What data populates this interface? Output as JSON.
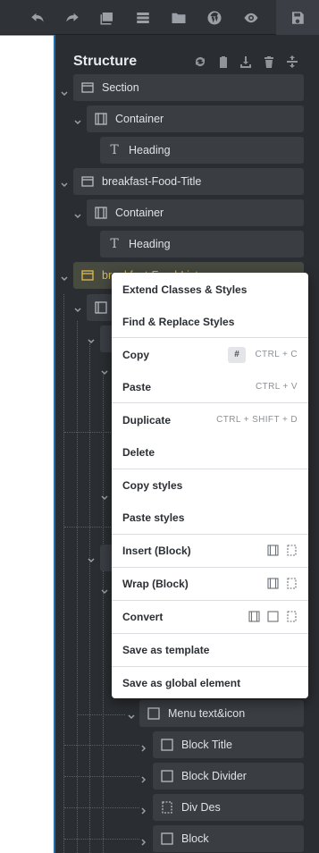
{
  "toolbar": {
    "buttons": [
      "undo-icon",
      "redo-icon",
      "image-icon",
      "list-icon",
      "folder-icon",
      "wordpress-icon",
      "eye-icon",
      "save-icon"
    ]
  },
  "structure": {
    "title": "Structure",
    "header_actions": [
      "refresh-icon",
      "clipboard-icon",
      "download-icon",
      "trash-icon",
      "collapse-icon"
    ],
    "items": [
      {
        "label": "Section",
        "type": "section"
      },
      {
        "label": "Container",
        "type": "container"
      },
      {
        "label": "Heading",
        "type": "heading"
      },
      {
        "label": "breakfast-Food-Title",
        "type": "section"
      },
      {
        "label": "Container",
        "type": "container"
      },
      {
        "label": "Heading",
        "type": "heading"
      },
      {
        "label": "breakfast-Food-List",
        "type": "section",
        "selected": true
      },
      {
        "label": "Menu text&icon",
        "type": "block"
      },
      {
        "label": "Block Title",
        "type": "block"
      },
      {
        "label": "Block Divider",
        "type": "block"
      },
      {
        "label": "Div Des",
        "type": "div"
      },
      {
        "label": "Block",
        "type": "block"
      }
    ]
  },
  "context_menu": {
    "items": [
      {
        "label": "Extend Classes & Styles"
      },
      {
        "label": "Find & Replace Styles"
      },
      {
        "label": "Copy",
        "badge": "#",
        "shortcut": "CTRL + C"
      },
      {
        "label": "Paste",
        "shortcut": "CTRL + V"
      },
      {
        "label": "Duplicate",
        "shortcut": "CTRL + SHIFT + D"
      },
      {
        "label": "Delete"
      },
      {
        "label": "Copy styles"
      },
      {
        "label": "Paste styles"
      },
      {
        "label": "Insert (Block)"
      },
      {
        "label": "Wrap (Block)"
      },
      {
        "label": "Convert"
      },
      {
        "label": "Save as template"
      },
      {
        "label": "Save as global element"
      }
    ]
  }
}
